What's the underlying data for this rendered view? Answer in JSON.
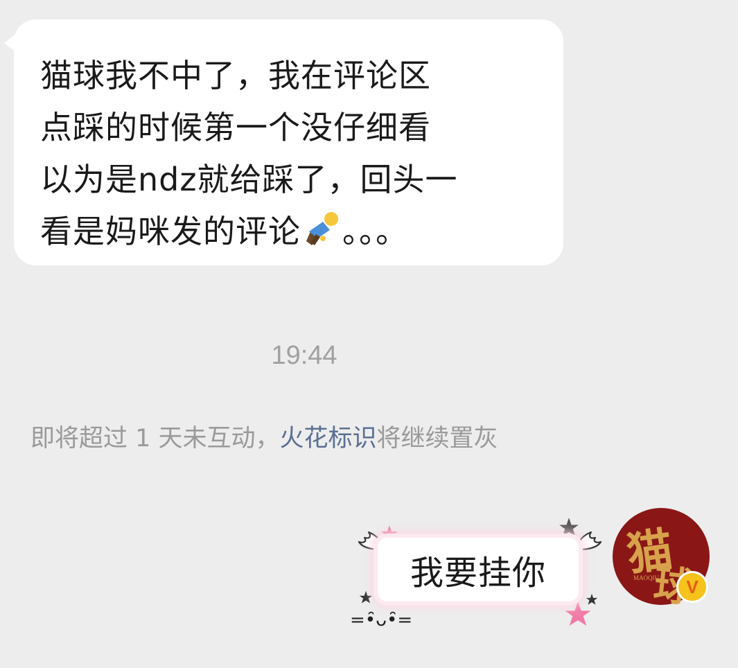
{
  "incoming_message": {
    "lines": [
      "猫球我不中了，我在评论区",
      "点踩的时候第一个没仔细看",
      "以为是ndz就给踩了，回头一",
      "看是妈咪发的评论",
      "。。。"
    ],
    "emoji": "person-lying-down-emoji"
  },
  "timestamp": "19:44",
  "notice": {
    "prefix": "即将超过 1 天未互动，",
    "link_text": "火花标识",
    "suffix": "将继续置灰"
  },
  "outgoing_message": {
    "text": "我要挂你",
    "kaomoji": "=•̑ᴗ•̑="
  },
  "avatar": {
    "char1": "猫",
    "char2": "球",
    "small_text": "MAOQIU",
    "badge": "V"
  },
  "colors": {
    "background": "#ededed",
    "bubble": "#ffffff",
    "link": "#5b6f93",
    "avatar_bg": "#8a1616",
    "avatar_gold": "#d7a24b",
    "star_pink": "#f27aa6",
    "star_gray": "#555555"
  }
}
